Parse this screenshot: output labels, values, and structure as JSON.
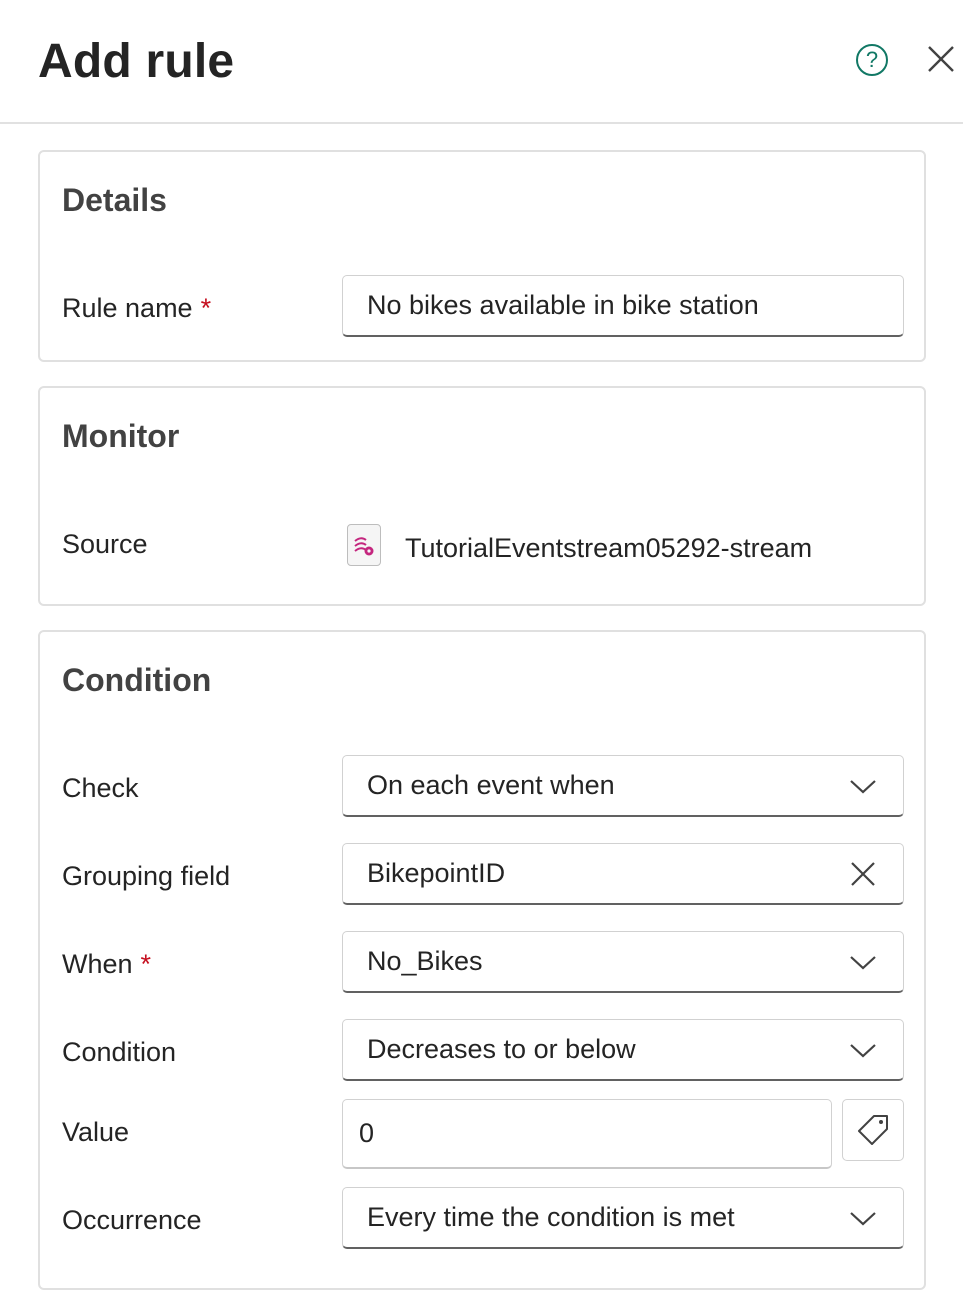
{
  "header": {
    "title": "Add rule"
  },
  "details": {
    "title": "Details",
    "rule_name_label": "Rule name",
    "required_mark": "*",
    "rule_name_value": "No bikes available in bike station"
  },
  "monitor": {
    "title": "Monitor",
    "source_label": "Source",
    "source_value": "TutorialEventstream05292-stream"
  },
  "condition": {
    "title": "Condition",
    "check_label": "Check",
    "check_value": "On each event when",
    "grouping_label": "Grouping field",
    "grouping_value": "BikepointID",
    "when_label": "When",
    "when_value": "No_Bikes",
    "condition_label": "Condition",
    "condition_value": "Decreases to or below",
    "value_label": "Value",
    "value_value": "0",
    "occurrence_label": "Occurrence",
    "occurrence_value": "Every time the condition is met"
  },
  "colors": {
    "accent": "#117865",
    "required": "#c50f1f",
    "source_icon": "#c4267e"
  },
  "icons": [
    "help-icon",
    "close-icon",
    "eventstream-icon",
    "chevron-down-icon",
    "clear-icon",
    "tag-icon"
  ]
}
